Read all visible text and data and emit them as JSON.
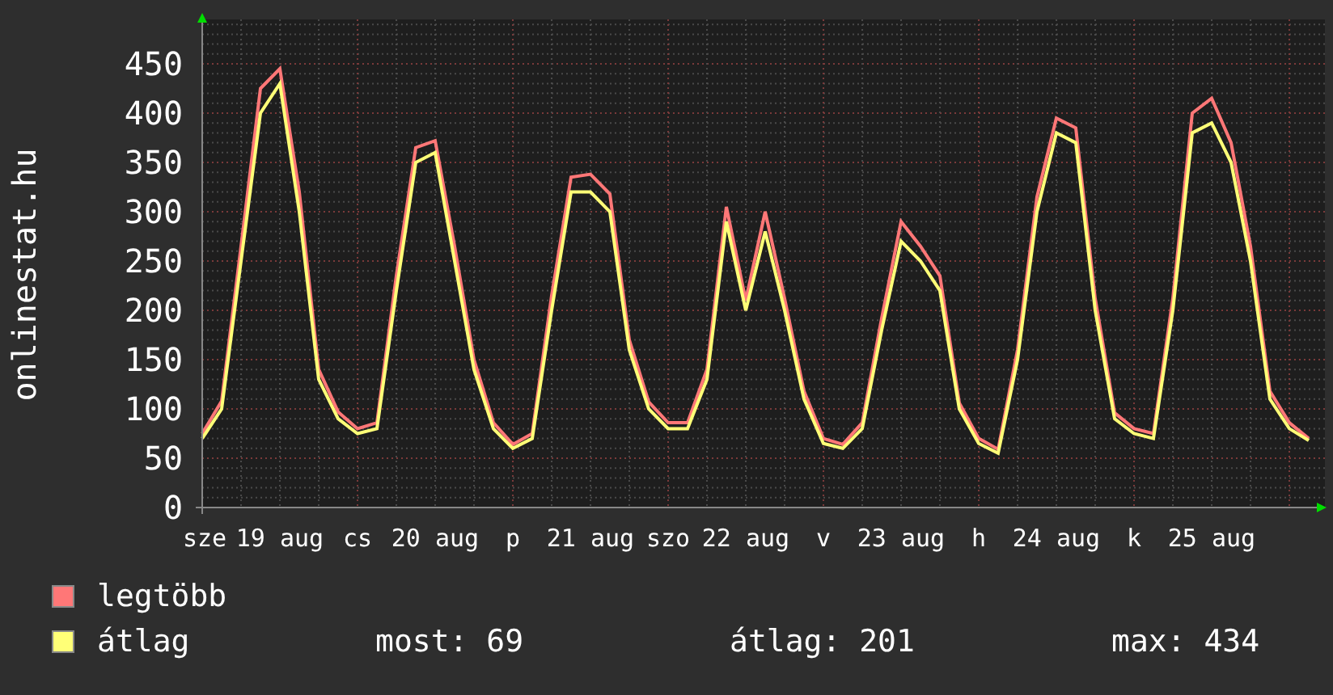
{
  "chart": {
    "chart_data": {
      "type": "line",
      "ylabel": "onlinestat.hu",
      "categories": [
        "sze",
        null,
        null,
        null,
        "19 aug",
        null,
        null,
        null,
        "cs",
        null,
        null,
        null,
        "20 aug",
        null,
        null,
        null,
        "p",
        null,
        null,
        null,
        "21 aug",
        null,
        null,
        null,
        "szo",
        null,
        null,
        null,
        "22 aug",
        null,
        null,
        null,
        "v",
        null,
        null,
        null,
        "23 aug",
        null,
        null,
        null,
        "h",
        null,
        null,
        null,
        "24 aug",
        null,
        null,
        null,
        "k",
        null,
        null,
        null,
        "25 aug",
        null,
        null,
        null,
        null,
        null
      ],
      "ylim": [
        0,
        495
      ],
      "grid": true,
      "yticks": [
        0,
        50,
        100,
        150,
        200,
        250,
        300,
        350,
        400,
        450
      ],
      "series": [
        {
          "name": "legtöbb",
          "color": "#ff7777",
          "values": [
            75,
            108,
            265,
            425,
            445,
            320,
            140,
            97,
            80,
            86,
            235,
            365,
            372,
            265,
            150,
            86,
            64,
            75,
            215,
            335,
            338,
            318,
            170,
            107,
            86,
            86,
            140,
            305,
            210,
            300,
            212,
            118,
            70,
            64,
            86,
            192,
            290,
            265,
            235,
            106,
            70,
            59,
            160,
            315,
            395,
            385,
            212,
            96,
            80,
            75,
            212,
            400,
            415,
            370,
            265,
            118,
            86,
            70
          ]
        },
        {
          "name": "átlag",
          "color": "#ffff77",
          "values": [
            70,
            100,
            250,
            400,
            430,
            300,
            130,
            90,
            75,
            80,
            220,
            350,
            360,
            250,
            140,
            80,
            60,
            70,
            200,
            320,
            320,
            300,
            160,
            100,
            80,
            80,
            130,
            290,
            200,
            280,
            200,
            110,
            65,
            60,
            80,
            180,
            270,
            250,
            220,
            100,
            65,
            55,
            150,
            300,
            380,
            370,
            200,
            90,
            75,
            70,
            200,
            380,
            390,
            350,
            250,
            110,
            80,
            68
          ]
        }
      ]
    }
  },
  "legend_stats": [
    "most: 69",
    "átlag: 201",
    "max: 434"
  ]
}
